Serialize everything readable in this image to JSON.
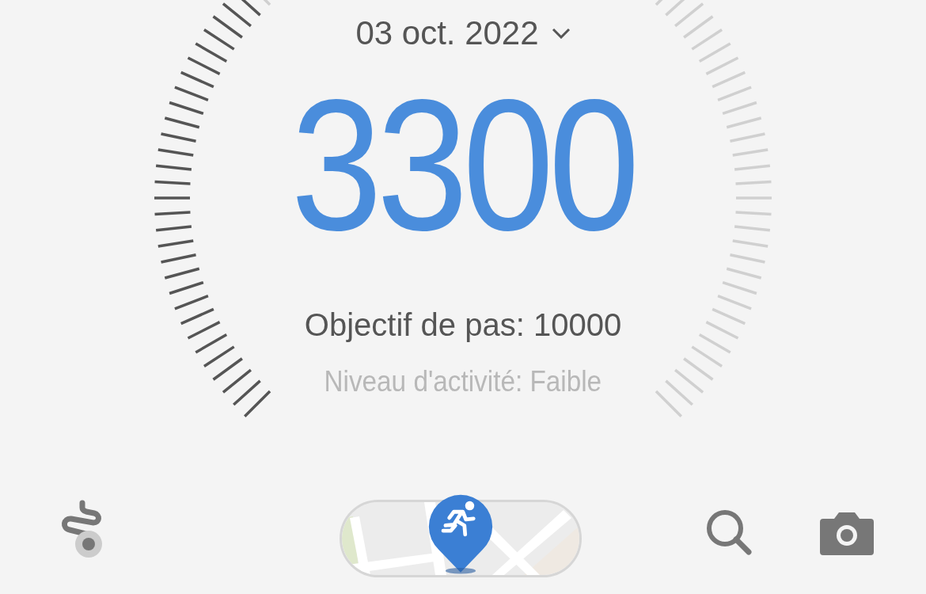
{
  "date_picker": {
    "label": "03 oct. 2022"
  },
  "steps": {
    "count": "3300"
  },
  "goal": "Objectif de pas: 10000",
  "activity": "Niveau d'activité: Faible"
}
